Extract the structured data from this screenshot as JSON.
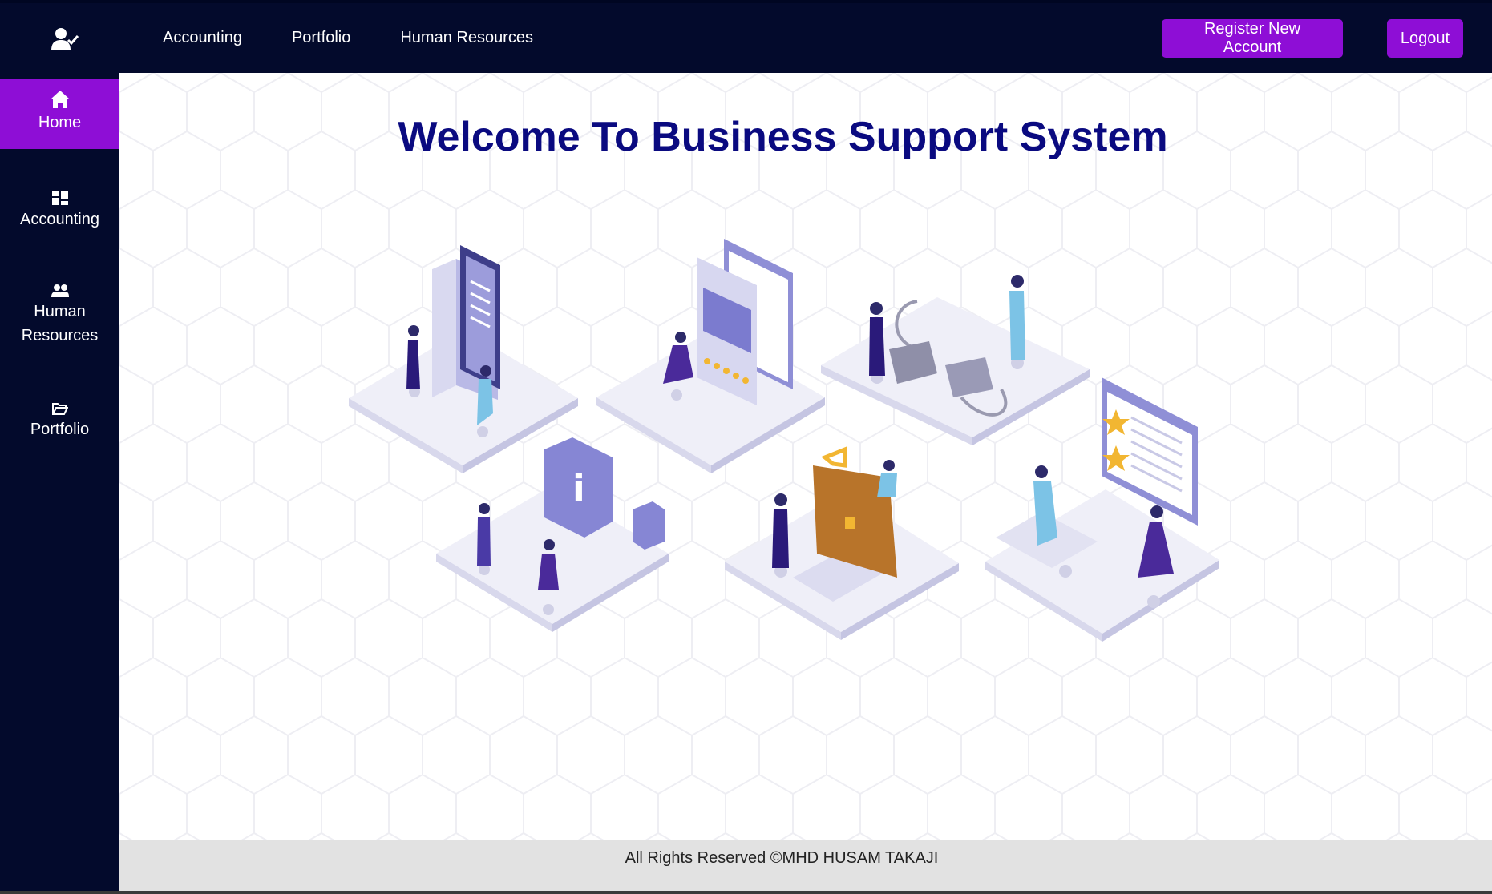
{
  "header": {
    "nav": [
      "Accounting",
      "Portfolio",
      "Human Resources"
    ],
    "register_label": "Register New Account",
    "logout_label": "Logout"
  },
  "sidebar": {
    "items": [
      {
        "label": "Home",
        "icon": "home-icon",
        "active": true
      },
      {
        "label": "Accounting",
        "icon": "dashboard-icon"
      },
      {
        "label": "Human Resources",
        "icon": "users-icon"
      },
      {
        "label": "Portfolio",
        "icon": "folder-open-icon"
      }
    ]
  },
  "main": {
    "title": "Welcome To Business Support System"
  },
  "footer": {
    "text": "All Rights Reserved ©MHD HUSAM TAKAJI"
  },
  "colors": {
    "navy": "#030a2c",
    "accent": "#8e0ed6",
    "title": "#0a0a80"
  }
}
